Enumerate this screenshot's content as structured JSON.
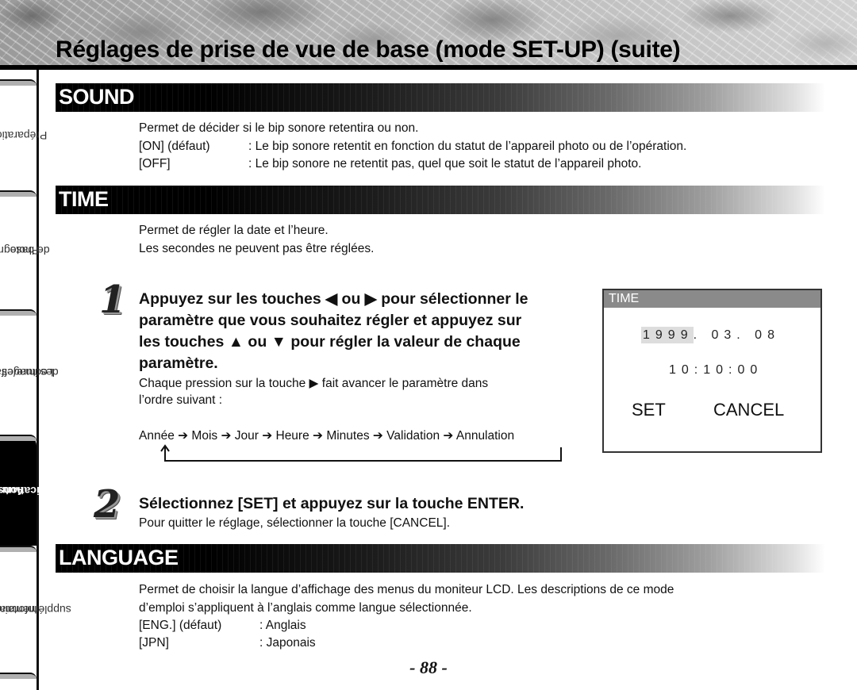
{
  "header": {
    "title": "Réglages de prise de vue de base (mode SET-UP) (suite)"
  },
  "sidebar": {
    "tabs": [
      {
        "label_line1": "Préparation",
        "label_line2": "",
        "active": false
      },
      {
        "label_line1": "Photographie",
        "label_line2": "de base",
        "active": false
      },
      {
        "label_line1": "Lecture/effacement",
        "label_line2": "des images",
        "active": false
      },
      {
        "label_line1": "Autres",
        "label_line2": "applications",
        "active": true
      },
      {
        "label_line1": "Informations",
        "label_line2": "supplémentaires",
        "active": false
      }
    ]
  },
  "sound": {
    "title": "SOUND",
    "intro": "Permet de décider si le bip sonore retentira ou non.",
    "options": [
      {
        "key": "[ON] (défaut)",
        "desc": ": Le bip sonore retentit en fonction du statut de l’appareil photo ou de l’opération."
      },
      {
        "key": "[OFF]",
        "desc": ": Le bip sonore ne retentit pas, quel que soit le statut de l’appareil photo."
      }
    ]
  },
  "time": {
    "title": "TIME",
    "intro_lines": [
      "Permet de régler la date et l’heure.",
      "Les secondes ne peuvent pas être réglées."
    ],
    "step1": {
      "number": "1",
      "heading_lines": [
        "Appuyez sur les touches ◀ ou ▶ pour sélectionner le",
        "paramètre que vous souhaitez régler et appuyez sur",
        "les touches ▲ ou ▼ pour régler la valeur de chaque",
        "paramètre."
      ],
      "body_lines": [
        "Chaque pression sur la touche ▶ fait avancer le paramètre dans",
        "l’ordre suivant :"
      ],
      "sequence": "Année ➔ Mois ➔ Jour ➔ Heure ➔ Minutes ➔ Validation ➔ Annulation"
    },
    "step2": {
      "number": "2",
      "heading": "Sélectionnez [SET] et appuyez sur la touche ENTER.",
      "body": "Pour quitter le réglage, sélectionner la touche [CANCEL]."
    },
    "lcd": {
      "title": "TIME",
      "year": "1999",
      "date_rest": ". 03. 08",
      "time": "10:10:00",
      "set_label": "SET",
      "cancel_label": "CANCEL"
    }
  },
  "language": {
    "title": "LANGUAGE",
    "intro_lines": [
      "Permet de choisir la langue d’affichage des menus du moniteur LCD. Les descriptions de ce mode",
      "d’emploi s’appliquent à l’anglais comme langue sélectionnée."
    ],
    "options": [
      {
        "key": "[ENG.] (défaut)",
        "desc": ": Anglais"
      },
      {
        "key": "[JPN]",
        "desc": ": Japonais"
      }
    ]
  },
  "footer": {
    "page_number": "- 88 -"
  }
}
